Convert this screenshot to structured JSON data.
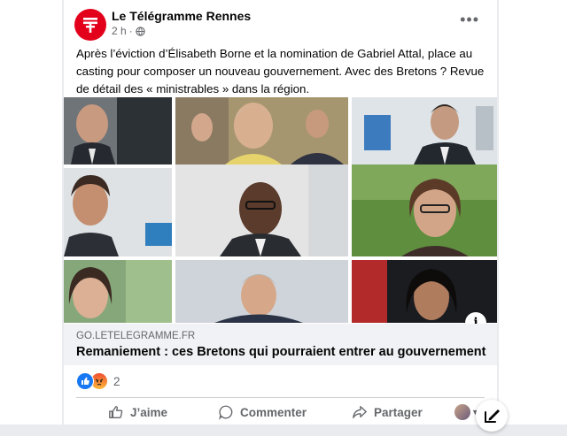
{
  "post": {
    "page_name": "Le Télégramme Rennes",
    "time": "2 h",
    "privacy_icon": "globe-icon",
    "more_icon": "more-options-icon",
    "text": "Après l’éviction d’Élisabeth Borne et la nomination de Gabriel Attal, place au casting pour composer un nouveau gouvernement. Avec des Bretons ? Revue de détail des « ministrables » dans la région."
  },
  "link": {
    "domain": "GO.LETELEGRAMME.FR",
    "title": "Remaniement : ces Bretons qui pourraient entrer au gouvernement",
    "info_label": "i"
  },
  "reactions": {
    "count": "2",
    "types": [
      "like",
      "angry"
    ]
  },
  "actions": {
    "like": "J’aime",
    "comment": "Commenter",
    "share": "Partager"
  },
  "colors": {
    "brand": "#e3001b",
    "facebook_blue": "#1877f2",
    "text_secondary": "#65676b"
  }
}
